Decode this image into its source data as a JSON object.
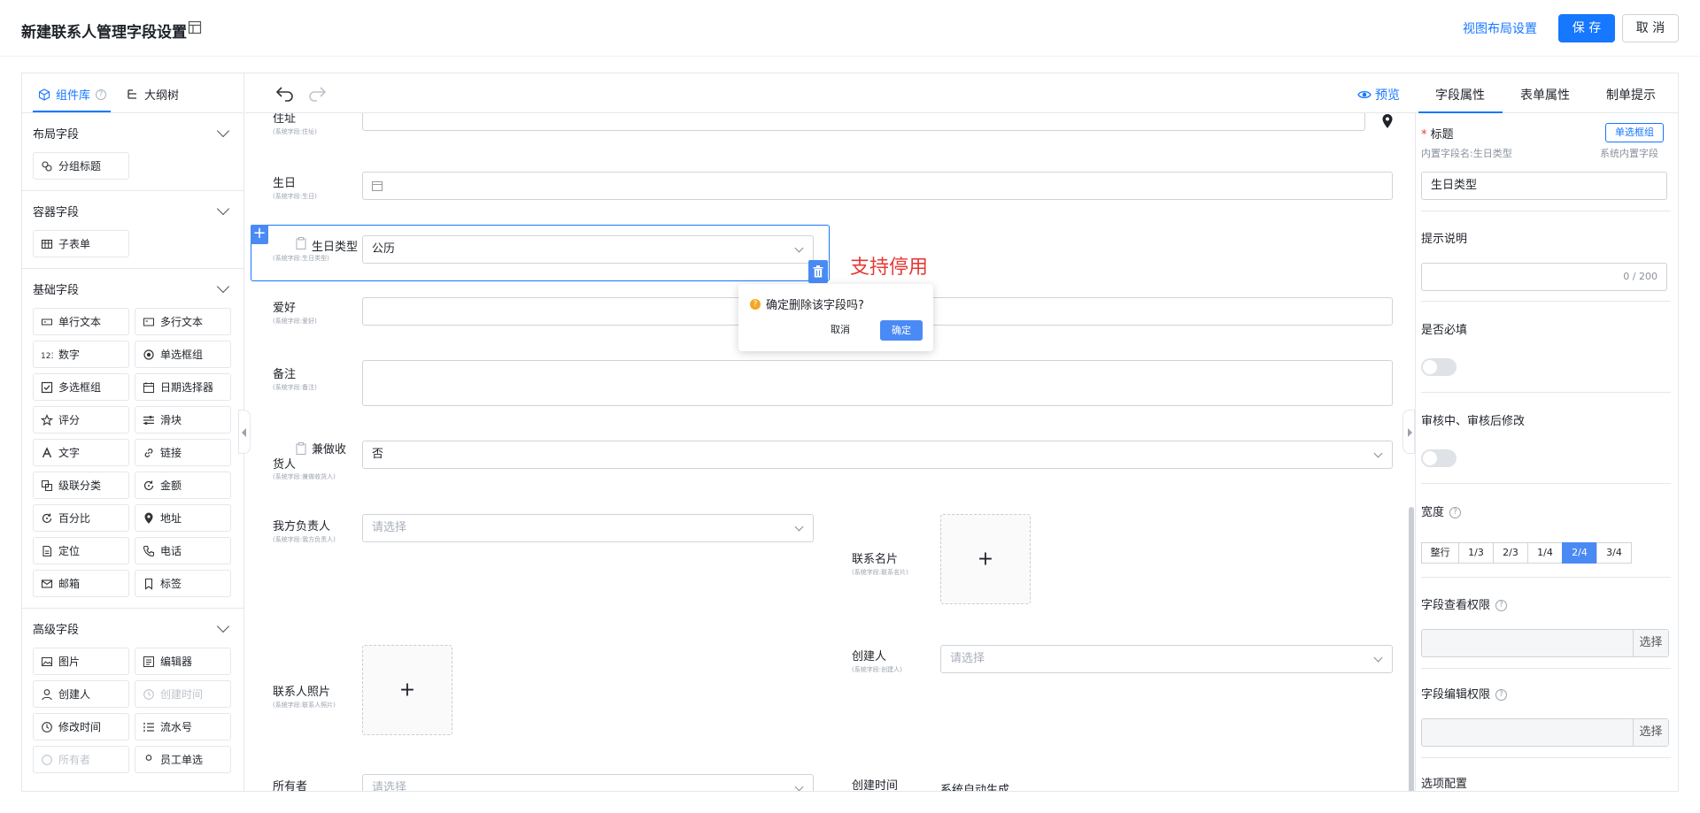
{
  "header": {
    "title": "新建联系人管理字段设置",
    "view_layout": "视图布局设置",
    "save": "保 存",
    "cancel": "取 消"
  },
  "left": {
    "tabs": [
      "组件库",
      "大纲树"
    ],
    "groups": {
      "layout": {
        "title": "布局字段",
        "items": [
          "分组标题"
        ]
      },
      "container": {
        "title": "容器字段",
        "items": [
          "子表单"
        ]
      },
      "basic": {
        "title": "基础字段",
        "items": [
          "单行文本",
          "多行文本",
          "数字",
          "单选框组",
          "多选框组",
          "日期选择器",
          "评分",
          "滑块",
          "文字",
          "链接",
          "级联分类",
          "金额",
          "百分比",
          "地址",
          "定位",
          "电话",
          "邮箱",
          "标签"
        ]
      },
      "advanced": {
        "title": "高级字段",
        "items": [
          "图片",
          "编辑器",
          "创建人",
          "创建时间",
          "修改时间",
          "流水号",
          "所有者",
          "员工单选"
        ]
      }
    }
  },
  "toolbar": {
    "preview": "预览"
  },
  "canvas": {
    "address": {
      "label": "住址",
      "sub": "(系统字段:住址)"
    },
    "birthday": {
      "label": "生日",
      "sub": "(系统字段:生日)"
    },
    "birthday_type": {
      "label": "生日类型",
      "sub": "(系统字段:生日类型)",
      "value": "公历"
    },
    "hobby": {
      "label": "爱好",
      "sub": "(系统字段:爱好)"
    },
    "remark": {
      "label": "备注",
      "sub": "(系统字段:备注)"
    },
    "consignee": {
      "label": "兼做收货人",
      "sub": "(系统字段:兼做收货人)",
      "value": "否"
    },
    "owner_resp": {
      "label": "我方负责人",
      "sub": "(系统字段:我方负责人)",
      "placeholder": "请选择"
    },
    "card": {
      "label": "联系名片",
      "sub": "(系统字段:联系名片)"
    },
    "creator": {
      "label": "创建人",
      "sub": "(系统字段:创建人)",
      "placeholder": "请选择"
    },
    "photo": {
      "label": "联系人照片",
      "sub": "(系统字段:联系人照片)"
    },
    "owner": {
      "label": "所有者",
      "placeholder": "请选择"
    },
    "create_time": {
      "label": "创建时间",
      "value": "系统自动生成"
    },
    "annotation": "支持停用",
    "popconfirm": {
      "text": "确定删除该字段吗?",
      "cancel": "取消",
      "ok": "确定"
    },
    "plus": "+"
  },
  "right": {
    "tabs": [
      "字段属性",
      "表单属性",
      "制单提示"
    ],
    "title_label": "标题",
    "required_mark": "*",
    "tag": "单选框组",
    "builtin_name": "内置字段名:生日类型",
    "builtin_type": "系统内置字段",
    "title_value": "生日类型",
    "hint_label": "提示说明",
    "hint_count": "0 / 200",
    "required_label": "是否必填",
    "audit_label": "审核中、审核后修改",
    "width_label": "宽度",
    "width_options": [
      "整行",
      "1/3",
      "2/3",
      "1/4",
      "2/4",
      "3/4"
    ],
    "width_selected": "2/4",
    "view_perm_label": "字段查看权限",
    "edit_perm_label": "字段编辑权限",
    "choose": "选择",
    "options_label": "选项配置"
  },
  "colors": {
    "primary": "#1677ff",
    "annotation": "#e53935",
    "warning": "#f5a623"
  }
}
